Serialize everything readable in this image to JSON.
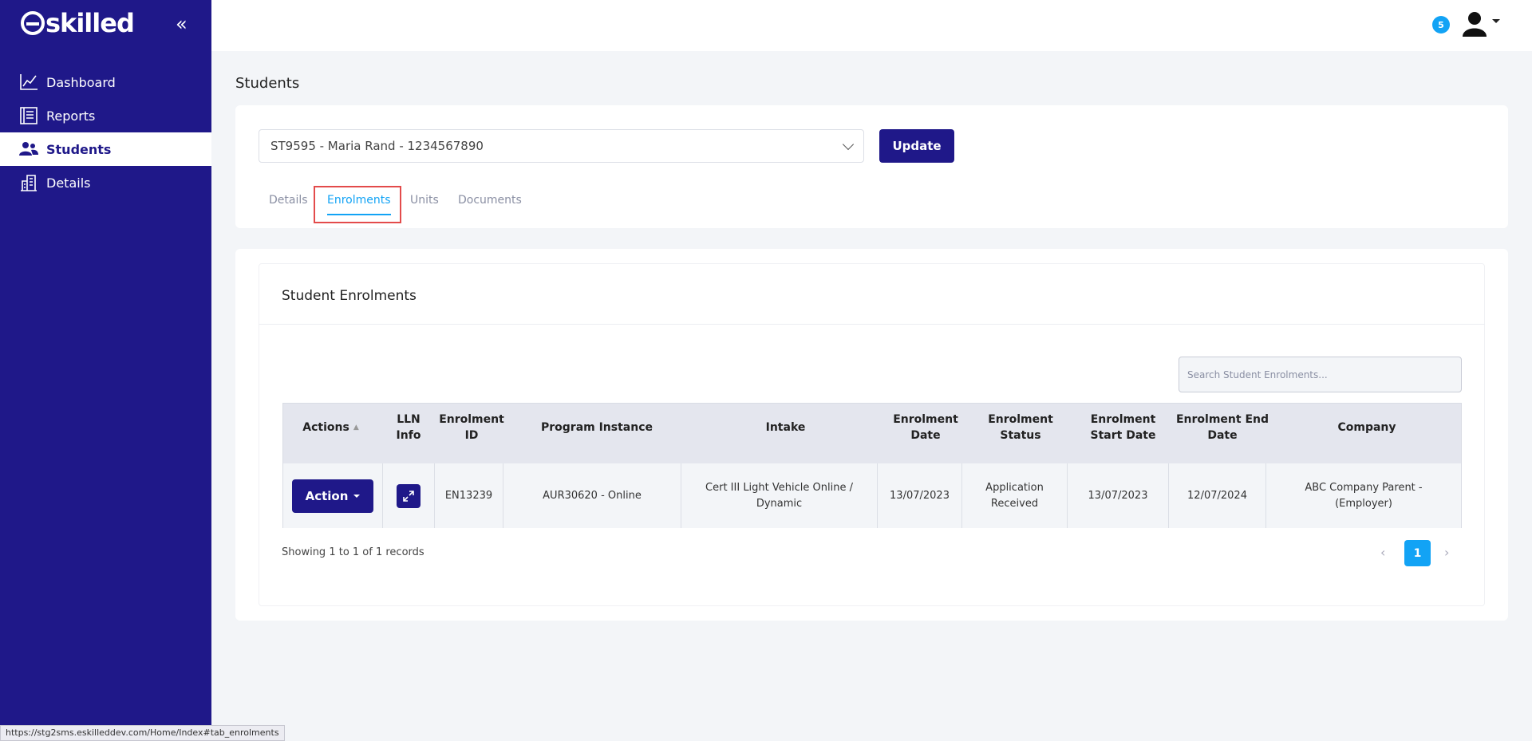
{
  "brand": {
    "logo_text": "skilled"
  },
  "sidebar": {
    "items": [
      {
        "label": "Dashboard",
        "icon": "chart-line-icon",
        "active": false
      },
      {
        "label": "Reports",
        "icon": "report-icon",
        "active": false
      },
      {
        "label": "Students",
        "icon": "users-icon",
        "active": true
      },
      {
        "label": "Details",
        "icon": "building-icon",
        "active": false
      }
    ]
  },
  "topbar": {
    "notification_count": "5"
  },
  "page": {
    "title": "Students"
  },
  "student_select": {
    "value": "ST9595 - Maria Rand - 1234567890"
  },
  "update_label": "Update",
  "tabs": [
    {
      "label": "Details"
    },
    {
      "label": "Enrolments"
    },
    {
      "label": "Units"
    },
    {
      "label": "Documents"
    }
  ],
  "enrolments": {
    "title": "Student Enrolments",
    "search_placeholder": "Search Student Enrolments...",
    "columns": [
      "Actions",
      "LLN Info",
      "Enrolment ID",
      "Program Instance",
      "Intake",
      "Enrolment Date",
      "Enrolment Status",
      "Enrolment Start Date",
      "Enrolment End Date",
      "Company"
    ],
    "rows": [
      {
        "action_label": "Action",
        "enrolment_id": "EN13239",
        "program_instance": "AUR30620 - Online",
        "intake": "Cert III Light Vehicle Online / Dynamic",
        "enrolment_date": "13/07/2023",
        "status": "Application Received",
        "start_date": "13/07/2023",
        "end_date": "12/07/2024",
        "company": "ABC Company Parent - (Employer)"
      }
    ],
    "showing_text": "Showing 1 to 1 of 1 records",
    "current_page": "1"
  },
  "status_url": "https://stg2sms.eskilleddev.com/Home/Index#tab_enrolments",
  "colors": {
    "sidebar": "#1f1889",
    "accent": "#12a3f5",
    "highlight": "#e34b4b"
  }
}
